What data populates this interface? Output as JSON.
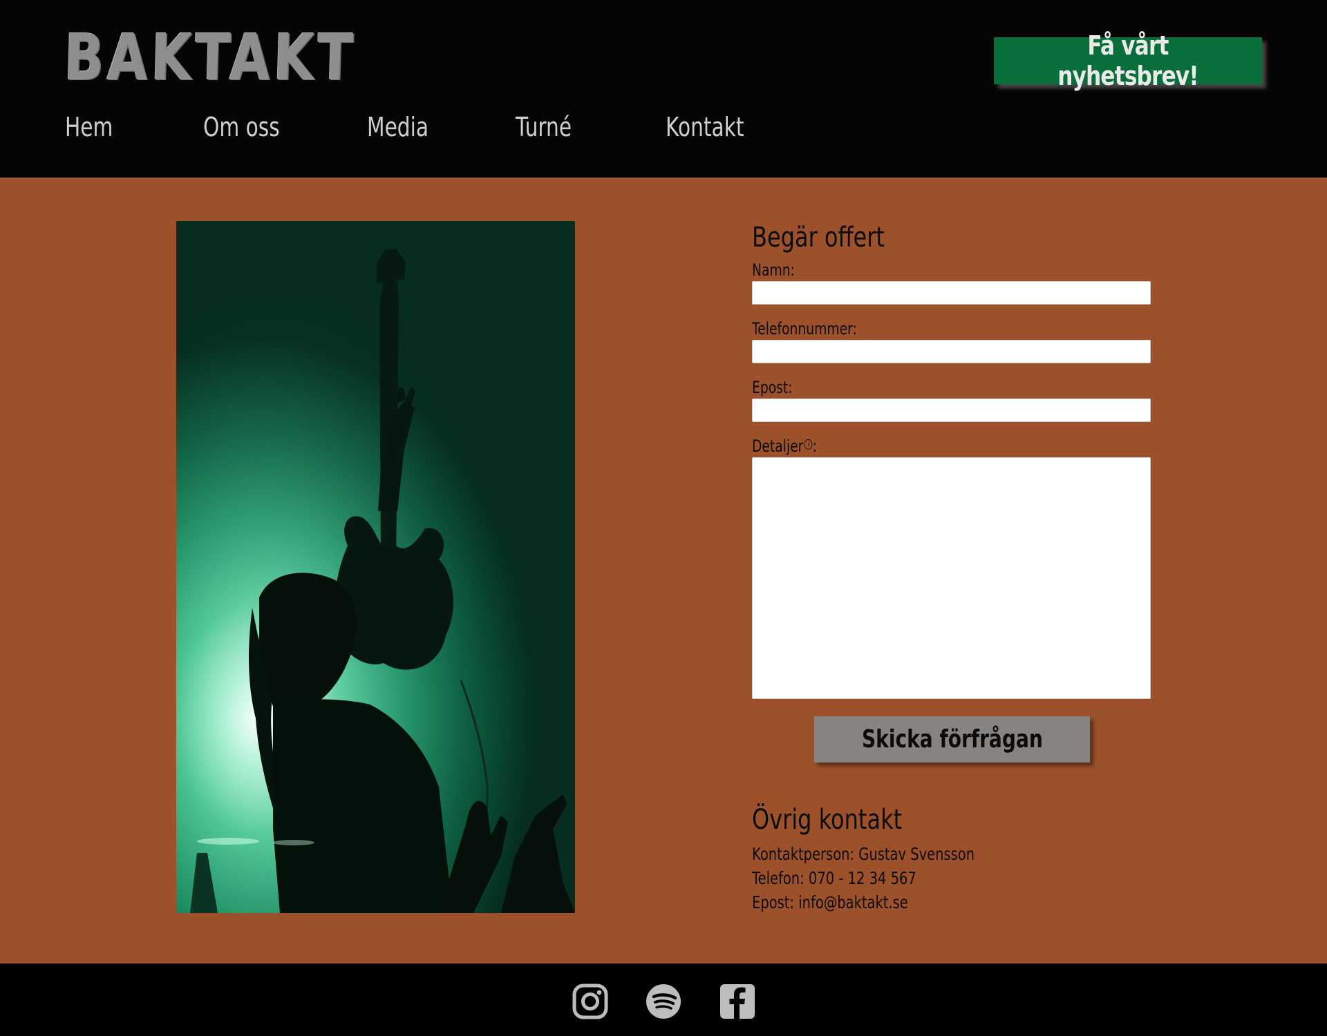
{
  "header": {
    "logo_text": "BAKTAKT",
    "newsletter_button": "Få vårt nyhetsbrev!"
  },
  "nav": {
    "items": [
      "Hem",
      "Om oss",
      "Media",
      "Turné",
      "Kontakt"
    ]
  },
  "form": {
    "title": "Begär offert",
    "name_label": "Namn:",
    "name_value": "",
    "phone_label": "Telefonnummer:",
    "phone_value": "",
    "email_label": "Epost:",
    "email_value": "",
    "details_label": "Detaljer",
    "details_suffix": ":",
    "details_info_icon": "info-icon",
    "details_value": "",
    "submit_label": "Skicka förfrågan"
  },
  "contact": {
    "title": "Övrig kontakt",
    "person": "Kontaktperson: Gustav Svensson",
    "phone": "Telefon: 070 - 12 34 567",
    "email": "Epost: info@baktakt.se"
  },
  "footer": {
    "social_icons": [
      "instagram-icon",
      "spotify-icon",
      "facebook-icon"
    ]
  },
  "colors": {
    "header_bg": "#050505",
    "main_bg": "#9c512a",
    "newsletter_button_bg": "#0a6e3a",
    "submit_button_bg": "#868381",
    "nav_text": "#cfcfcf"
  }
}
